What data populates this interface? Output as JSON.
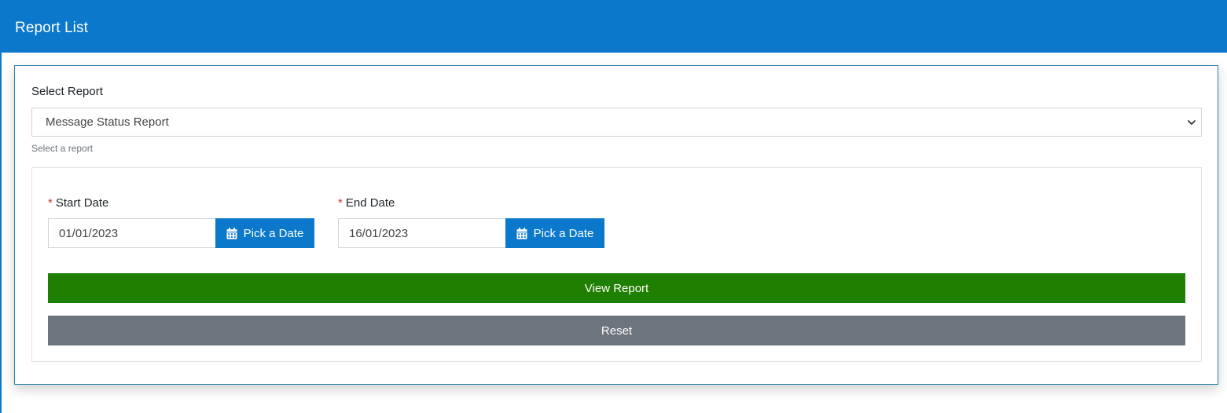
{
  "header": {
    "title": "Report List"
  },
  "report_select": {
    "label": "Select Report",
    "selected_value": "Message Status Report",
    "help_text": "Select a report",
    "chevron_icon": "chevron-down-icon"
  },
  "date_filters": {
    "required_marker": "*",
    "start": {
      "label": "Start Date",
      "value": "01/01/2023",
      "pick_label": "Pick a Date",
      "icon": "calendar-icon"
    },
    "end": {
      "label": "End Date",
      "value": "16/01/2023",
      "pick_label": "Pick a Date",
      "icon": "calendar-icon"
    }
  },
  "actions": {
    "view_label": "View Report",
    "reset_label": "Reset"
  },
  "colors": {
    "header_bg": "#0b78cc",
    "pick_button_bg": "#0b78cc",
    "view_button_bg": "#1e7f00",
    "reset_button_bg": "#6c757d",
    "required_marker": "#c0392b"
  }
}
